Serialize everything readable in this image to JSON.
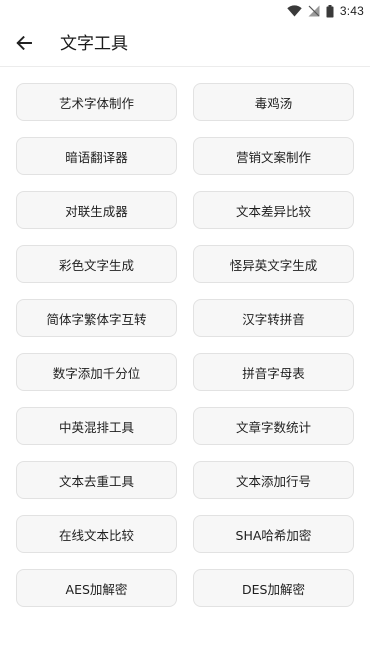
{
  "status_bar": {
    "time": "3:43"
  },
  "app_bar": {
    "title": "文字工具"
  },
  "tools": [
    {
      "label": "艺术字体制作"
    },
    {
      "label": "毒鸡汤"
    },
    {
      "label": "暗语翻译器"
    },
    {
      "label": "营销文案制作"
    },
    {
      "label": "对联生成器"
    },
    {
      "label": "文本差异比较"
    },
    {
      "label": "彩色文字生成"
    },
    {
      "label": "怪异英文字生成"
    },
    {
      "label": "简体字繁体字互转"
    },
    {
      "label": "汉字转拼音"
    },
    {
      "label": "数字添加千分位"
    },
    {
      "label": "拼音字母表"
    },
    {
      "label": "中英混排工具"
    },
    {
      "label": "文章字数统计"
    },
    {
      "label": "文本去重工具"
    },
    {
      "label": "文本添加行号"
    },
    {
      "label": "在线文本比较"
    },
    {
      "label": "SHA哈希加密"
    },
    {
      "label": "AES加解密"
    },
    {
      "label": "DES加解密"
    }
  ]
}
